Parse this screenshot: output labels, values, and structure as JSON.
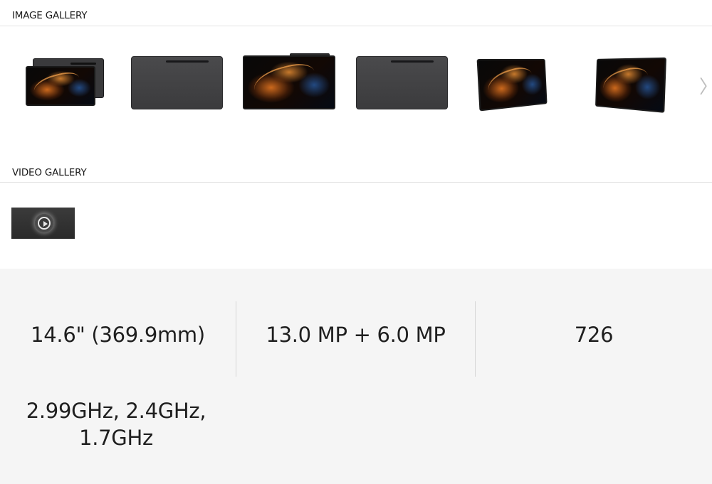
{
  "image_gallery": {
    "title": "IMAGE GALLERY",
    "thumbnails": [
      {
        "icon": "tablet-front-back-image"
      },
      {
        "icon": "tablet-back-image"
      },
      {
        "icon": "tablet-front-pen-image"
      },
      {
        "icon": "tablet-back-image"
      },
      {
        "icon": "tablet-angle-left-image"
      },
      {
        "icon": "tablet-angle-right-image"
      }
    ],
    "next_arrow": "〉"
  },
  "video_gallery": {
    "title": "VIDEO GALLERY",
    "videos": [
      {
        "icon": "play-icon"
      }
    ]
  },
  "specs": [
    {
      "value": "14.6\" (369.9mm)"
    },
    {
      "value": "13.0 MP + 6.0 MP"
    },
    {
      "value": "726"
    },
    {
      "value_line1": "2.99GHz, 2.4GHz,",
      "value_line2": "1.7GHz"
    }
  ],
  "colors": {
    "specs_background": "#f5f5f5",
    "divider": "#d6d6d6",
    "header_rule": "#e4e4e4"
  }
}
